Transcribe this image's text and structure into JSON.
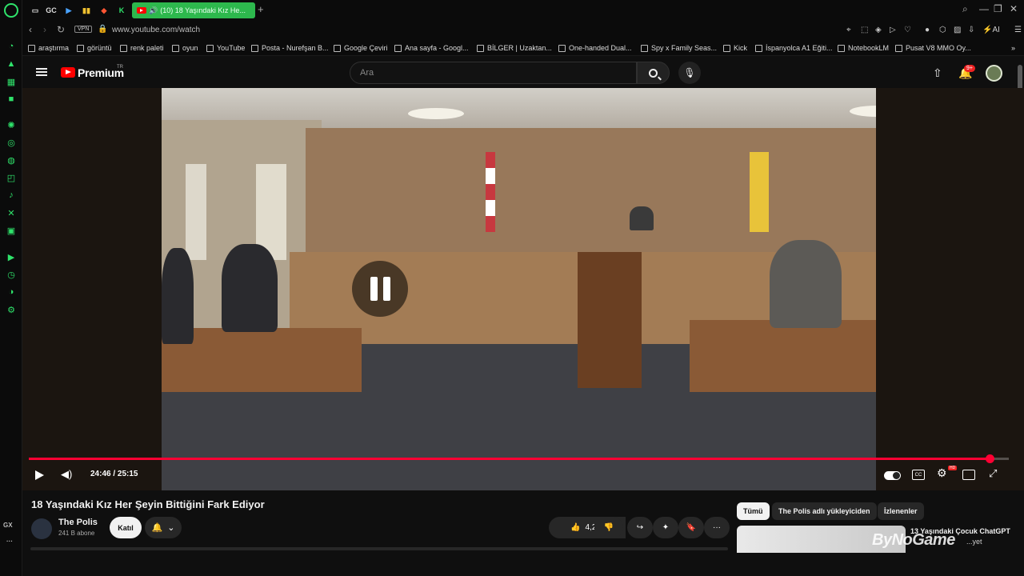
{
  "browser": {
    "tab_title": "(10) 18 Yaşındaki Kız He...",
    "tab_minis": [
      "GC",
      "▶",
      "▮▮",
      "◆",
      "K"
    ],
    "url": "www.youtube.com/watch",
    "vpn_label": "VPN",
    "ai_label": "AI",
    "sidebar_bottom_label": "GX",
    "accent_color": "#2fe36b"
  },
  "bookmarks": [
    {
      "label": "araştırma"
    },
    {
      "label": "görüntü"
    },
    {
      "label": "renk paleti"
    },
    {
      "label": "oyun"
    },
    {
      "label": "YouTube"
    },
    {
      "label": "Posta - Nurefşan B..."
    },
    {
      "label": "Google Çeviri"
    },
    {
      "label": "Ana sayfa - Googl..."
    },
    {
      "label": "BİLGER | Uzaktan..."
    },
    {
      "label": "One-handed Dual..."
    },
    {
      "label": "Spy x Family Seas..."
    },
    {
      "label": "Kick"
    },
    {
      "label": "İspanyolca A1 Eğiti..."
    },
    {
      "label": "NotebookLM"
    },
    {
      "label": "Pusat V8 MMO Oy..."
    }
  ],
  "youtube": {
    "brand": "Premium",
    "region": "TR",
    "search_placeholder": "Ara",
    "notif_count": "9+"
  },
  "player": {
    "current_time": "24:46 / 25:15",
    "progress_fraction": 0.98
  },
  "video": {
    "title": "18 Yaşındaki Kız Her Şeyin Bittiğini Fark Ediyor",
    "channel": "The Polis",
    "subscribers": "241 B abone",
    "join_label": "Katıl",
    "likes": "4,2 B"
  },
  "chips": [
    "Tümü",
    "The Polis adlı yükleyiciden",
    "İzlenenler"
  ],
  "recommendation": {
    "title": "13 Yaşındaki Çocuk ChatGPT",
    "subtitle": "...yet",
    "watermark": "ByNoGame"
  }
}
